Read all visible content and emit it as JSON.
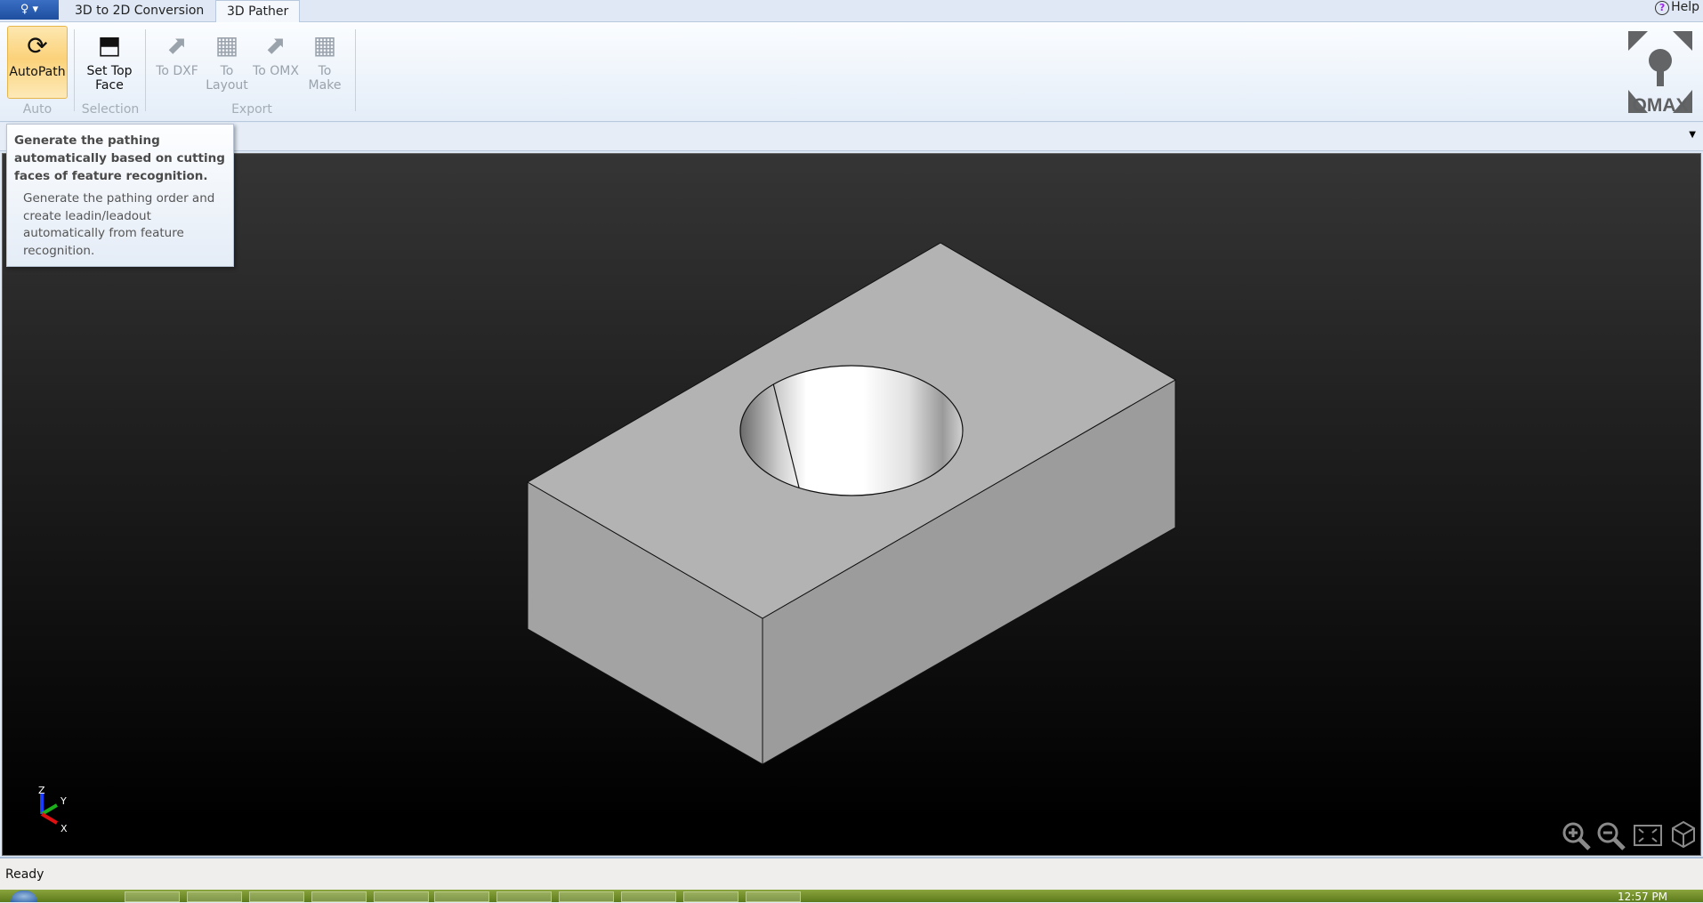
{
  "tabs": [
    {
      "label": "3D to 2D Conversion"
    },
    {
      "label": "3D Pather",
      "active": true
    }
  ],
  "app_button": "♀ ▾",
  "help": "Help",
  "ribbon": {
    "autopath": "AutoPath",
    "group_auto": "Auto",
    "set_top_face": "Set Top Face",
    "group_selection": "Selection",
    "to_dxf": "To DXF",
    "to_layout": "To Layout",
    "to_omx": "To OMX",
    "to_make": "To Make",
    "group_export": "Export"
  },
  "logo": "OMAX",
  "tooltip": {
    "title": "Generate the pathing automatically based on cutting faces of feature recognition.",
    "description": "Generate the pathing order and create leadin/leadout automatically from feature recognition."
  },
  "axes": {
    "x": "X",
    "y": "Y",
    "z": "Z"
  },
  "status": "Ready",
  "clock": "12:57 PM",
  "colors": {
    "ribbon_active": "#fbd27a",
    "viewport_bg": "#000000",
    "part": "#b0b0b0",
    "taskbar": "#6e8c28"
  }
}
